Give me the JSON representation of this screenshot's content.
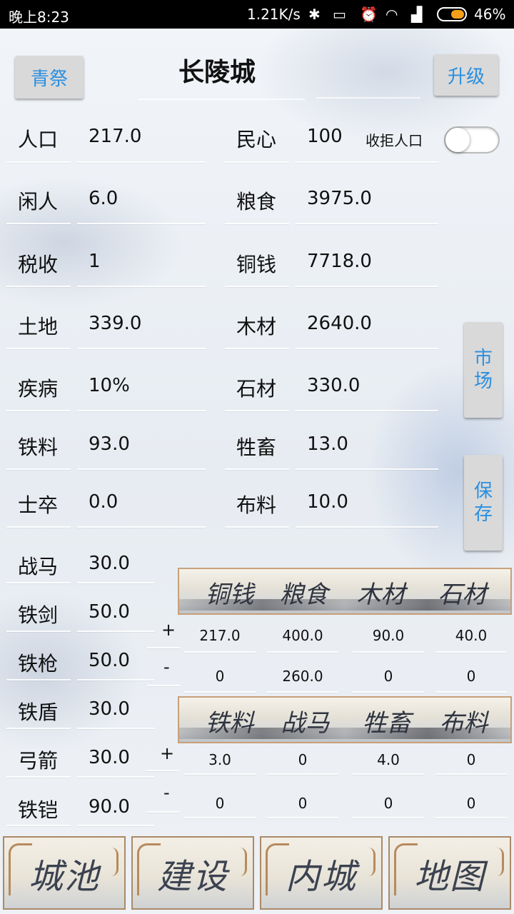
{
  "status": {
    "time": "晚上8:23",
    "speed": "1.21K/s",
    "battery_pct": "46%",
    "icons": [
      "bluetooth-icon",
      "vibrate-icon",
      "alarm-icon",
      "wifi-icon",
      "signal-icon",
      "battery-icon"
    ]
  },
  "header": {
    "title": "长陵城",
    "left_button": "青祭",
    "right_button": "升级"
  },
  "stats": {
    "left": [
      {
        "label": "人口",
        "value": "217.0"
      },
      {
        "label": "闲人",
        "value": "6.0"
      },
      {
        "label": "税收",
        "value": "1"
      },
      {
        "label": "土地",
        "value": "339.0"
      },
      {
        "label": "疾病",
        "value": "10%"
      },
      {
        "label": "铁料",
        "value": "93.0"
      },
      {
        "label": "士卒",
        "value": "0.0"
      }
    ],
    "right": [
      {
        "label": "民心",
        "value": "100"
      },
      {
        "label": "粮食",
        "value": "3975.0"
      },
      {
        "label": "铜钱",
        "value": "7718.0"
      },
      {
        "label": "木材",
        "value": "2640.0"
      },
      {
        "label": "石材",
        "value": "330.0"
      },
      {
        "label": "牲畜",
        "value": "13.0"
      },
      {
        "label": "布料",
        "value": "10.0"
      }
    ],
    "refuse_label": "收拒人口",
    "refuse_on": false
  },
  "military": [
    {
      "label": "战马",
      "value": "30.0"
    },
    {
      "label": "铁剑",
      "value": "50.0"
    },
    {
      "label": "铁枪",
      "value": "50.0"
    },
    {
      "label": "铁盾",
      "value": "30.0"
    },
    {
      "label": "弓箭",
      "value": "30.0"
    },
    {
      "label": "铁铠",
      "value": "90.0"
    }
  ],
  "side_buttons": {
    "market": [
      "市",
      "场"
    ],
    "save": [
      "保",
      "存"
    ]
  },
  "trade1": {
    "headers": [
      "铜钱",
      "粮食",
      "木材",
      "石材"
    ],
    "plus_label": "+",
    "minus_label": "-",
    "plus": [
      "217.0",
      "400.0",
      "90.0",
      "40.0"
    ],
    "minus": [
      "0",
      "260.0",
      "0",
      "0"
    ]
  },
  "trade2": {
    "headers": [
      "铁料",
      "战马",
      "牲畜",
      "布料"
    ],
    "plus_label": "+",
    "minus_label": "-",
    "plus": [
      "3.0",
      "0",
      "4.0",
      "0"
    ],
    "minus": [
      "0",
      "0",
      "0",
      "0"
    ]
  },
  "nav": [
    "城池",
    "建设",
    "内城",
    "地图"
  ]
}
